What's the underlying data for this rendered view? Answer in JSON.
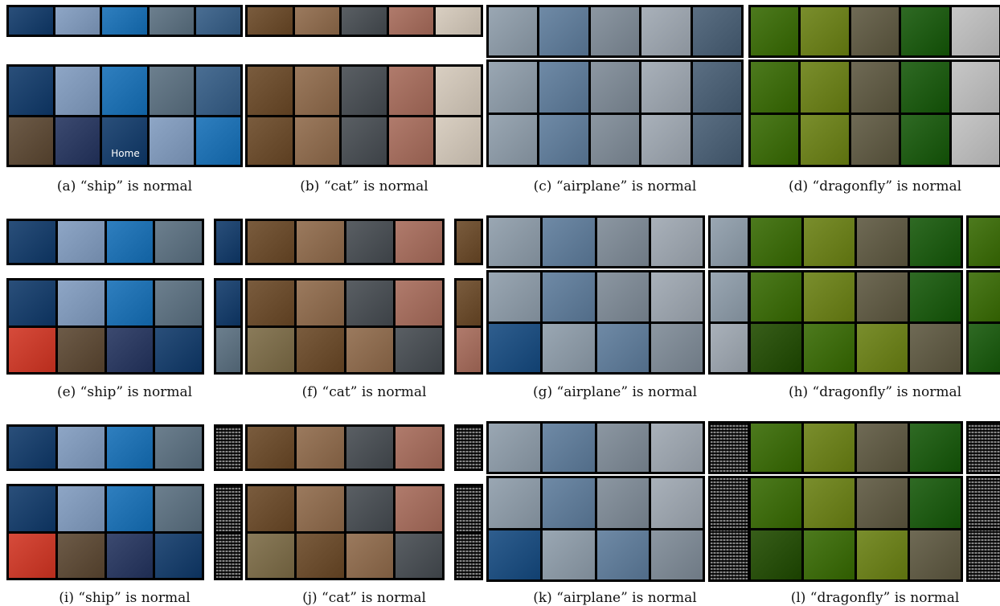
{
  "captions": [
    "(a) “ship” is normal",
    "(b) “cat” is normal",
    "(c) “airplane” is normal",
    "(d) “dragonfly” is normal",
    "(e) “ship” is normal",
    "(f) “cat” is normal",
    "(g) “airplane” is normal",
    "(h) “dragonfly” is normal",
    "(i) “ship” is normal",
    "(j) “cat” is normal",
    "(k) “airplane” is normal",
    "(l) “dragonfly” is normal"
  ],
  "tile_text": {
    "home_sign": "Home"
  },
  "colors": {
    "frame": "#000000",
    "ship": [
      "#2a4f7a",
      "#8ea6c6",
      "#2f7fbf",
      "#6c7f8e",
      "#4a6e93",
      "#c0392b",
      "#d64b3b",
      "#6d5b48",
      "#3c4a70"
    ],
    "cat": [
      "#7a5c3e",
      "#9b7a5e",
      "#5a5f64",
      "#b07b6c",
      "#d9cfc2",
      "#6b7d55",
      "#8a7b5a"
    ],
    "airplane": [
      "#9aa7b3",
      "#6f8aa6",
      "#8c97a2",
      "#a9b1ba",
      "#5b6f83",
      "#c7cfd8",
      "#2f5e8e"
    ],
    "dragonfly": [
      "#4d7a1e",
      "#7a8e2d",
      "#6f6a55",
      "#2f6a24",
      "#c7c7c7",
      "#a3c13b",
      "#385e1a"
    ]
  }
}
